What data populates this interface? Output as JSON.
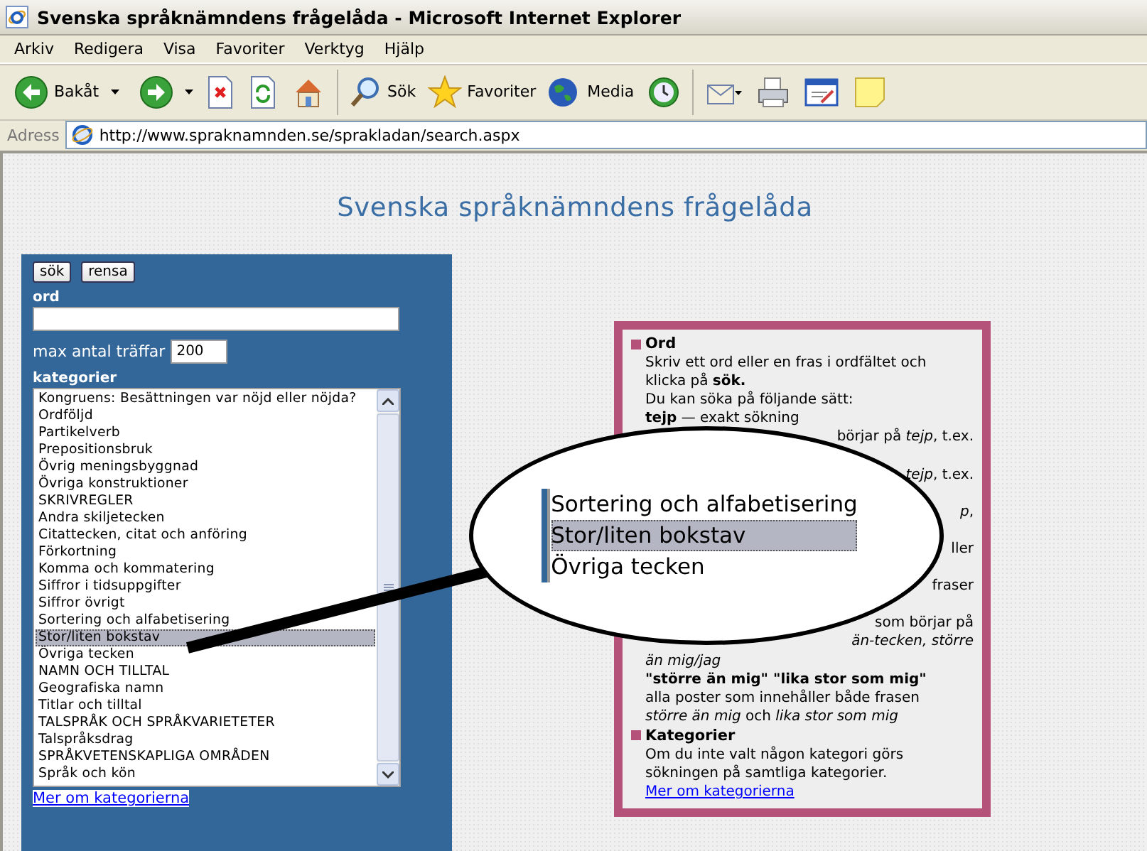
{
  "window": {
    "title": "Svenska språknämndens frågelåda - Microsoft Internet Explorer"
  },
  "menu": [
    "Arkiv",
    "Redigera",
    "Visa",
    "Favoriter",
    "Verktyg",
    "Hjälp"
  ],
  "toolbar": {
    "back": "Bakåt",
    "search": "Sök",
    "favorites": "Favoriter",
    "media": "Media"
  },
  "address": {
    "label": "Adress",
    "url": "http://www.spraknamnden.se/sprakladan/search.aspx"
  },
  "page_title": "Svenska språknämndens frågelåda",
  "search_panel": {
    "buttons": [
      "sök",
      "rensa"
    ],
    "word_label": "ord",
    "max_label": "max antal träffar",
    "max_value": "200",
    "categories_label": "kategorier",
    "categories": [
      {
        "label": "Kongruens: Besättningen var nöjd eller nöjda?",
        "selected": false
      },
      {
        "label": "Ordföljd",
        "selected": false
      },
      {
        "label": "Partikelverb",
        "selected": false
      },
      {
        "label": "Prepositionsbruk",
        "selected": false
      },
      {
        "label": "Övrig meningsbyggnad",
        "selected": false
      },
      {
        "label": "Övriga konstruktioner",
        "selected": false
      },
      {
        "label": "SKRIVREGLER",
        "selected": false
      },
      {
        "label": "Andra skiljetecken",
        "selected": false
      },
      {
        "label": "Citattecken, citat och anföring",
        "selected": false
      },
      {
        "label": "Förkortning",
        "selected": false
      },
      {
        "label": "Komma och kommatering",
        "selected": false
      },
      {
        "label": "Siffror i tidsuppgifter",
        "selected": false
      },
      {
        "label": "Siffror övrigt",
        "selected": false
      },
      {
        "label": "Sortering och alfabetisering",
        "selected": false
      },
      {
        "label": "Stor/liten bokstav",
        "selected": true
      },
      {
        "label": "Övriga tecken",
        "selected": false
      },
      {
        "label": "NAMN OCH TILLTAL",
        "selected": false
      },
      {
        "label": "Geografiska namn",
        "selected": false
      },
      {
        "label": "Titlar och tilltal",
        "selected": false
      },
      {
        "label": "TALSPRÅK OCH SPRÅKVARIETETER",
        "selected": false
      },
      {
        "label": "Talspråksdrag",
        "selected": false
      },
      {
        "label": "SPRÅKVETENSKAPLIGA OMRÅDEN",
        "selected": false
      },
      {
        "label": "Språk och kön",
        "selected": false
      }
    ],
    "link": "Mer om kategorierna"
  },
  "help": [
    {
      "heading": "Ord",
      "lines": [
        {
          "kind": "text",
          "text": "Skriv ett ord eller en fras i ordfältet och"
        },
        {
          "kind": "text",
          "text": "klicka på **sök.**"
        },
        {
          "kind": "text",
          "text": "Du kan söka på följande sätt:"
        },
        {
          "kind": "text",
          "text": "**tejp** — exakt sökning"
        },
        {
          "kind": "fragment",
          "text": "börjar på *tejp*, t.ex."
        },
        {
          "kind": "covered"
        },
        {
          "kind": "fragment",
          "text": "*tejp*, t.ex."
        },
        {
          "kind": "covered"
        },
        {
          "kind": "fragment",
          "text": "*p*,"
        },
        {
          "kind": "covered"
        },
        {
          "kind": "fragment",
          "text": "ller"
        },
        {
          "kind": "covered"
        },
        {
          "kind": "fragment",
          "text": "fraser"
        },
        {
          "kind": "covered"
        },
        {
          "kind": "fragment",
          "text": "som börjar på"
        },
        {
          "kind": "fragment",
          "text": "*än-tecken, större*"
        },
        {
          "kind": "text",
          "text": "*än mig/jag*"
        },
        {
          "kind": "text",
          "text": "**\"större än mig\" \"lika stor som mig\"**"
        },
        {
          "kind": "text",
          "text": "alla poster som innehåller både frasen"
        },
        {
          "kind": "text",
          "text": "*större än mig* och *lika stor som mig*"
        }
      ]
    },
    {
      "heading": "Kategorier",
      "lines": [
        {
          "kind": "text",
          "text": "Om du inte valt någon kategori görs"
        },
        {
          "kind": "text",
          "text": "sökningen på samtliga kategorier."
        },
        {
          "kind": "link",
          "text": "Mer om kategorierna"
        }
      ]
    }
  ],
  "callout": {
    "items": [
      {
        "label": "Sortering och alfabetisering",
        "selected": false
      },
      {
        "label": "Stor/liten bokstav",
        "selected": true
      },
      {
        "label": "Övriga tecken",
        "selected": false
      }
    ]
  }
}
